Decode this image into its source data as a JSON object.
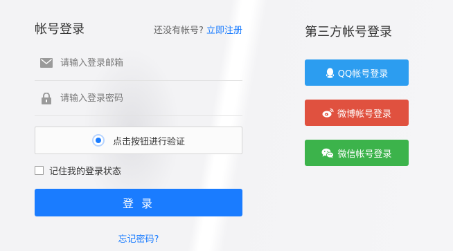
{
  "login": {
    "title": "帐号登录",
    "no_account_text": "还没有帐号?",
    "register_link": "立即注册",
    "email_placeholder": "请输入登录邮箱",
    "password_placeholder": "请输入登录密码",
    "verify_label": "点击按钮进行验证",
    "remember_label": "记住我的登录状态",
    "login_button": "登 录",
    "forgot_link": "忘记密码?"
  },
  "third_party": {
    "title": "第三方帐号登录",
    "buttons": [
      {
        "label": "QQ帐号登录",
        "icon": "qq-icon",
        "color": "#2c9df0"
      },
      {
        "label": "微博帐号登录",
        "icon": "weibo-icon",
        "color": "#e0513f"
      },
      {
        "label": "微信帐号登录",
        "icon": "wechat-icon",
        "color": "#3cb34b"
      }
    ]
  },
  "colors": {
    "accent": "#1a7cff",
    "text": "#333333",
    "muted": "#666666"
  }
}
